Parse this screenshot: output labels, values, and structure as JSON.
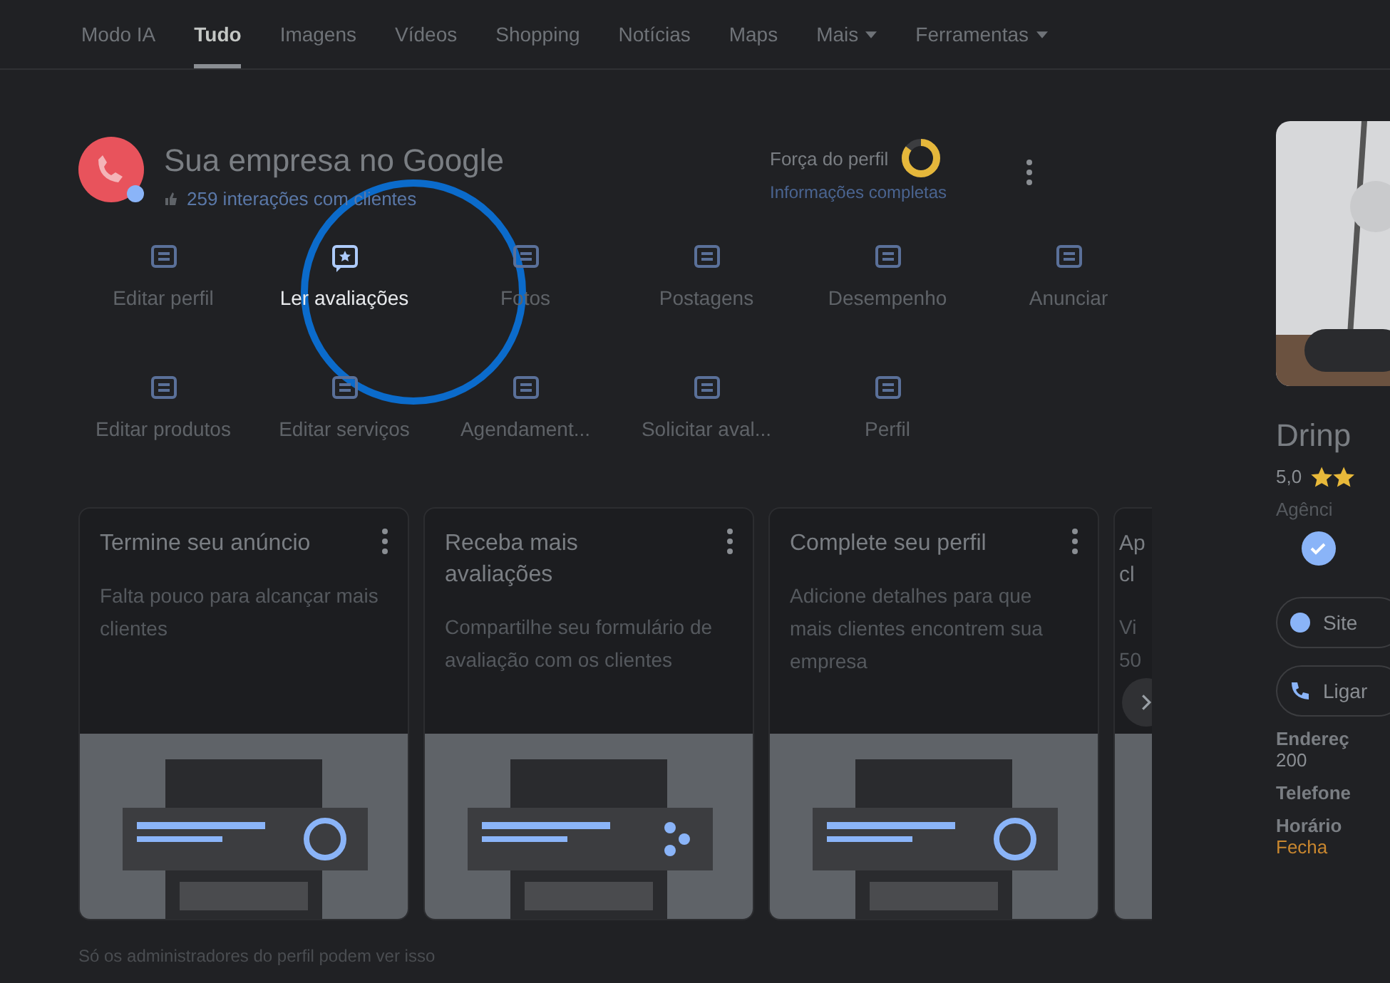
{
  "tabs": [
    {
      "label": "Modo IA",
      "selected": false,
      "has_menu": false
    },
    {
      "label": "Tudo",
      "selected": true,
      "has_menu": false
    },
    {
      "label": "Imagens",
      "selected": false,
      "has_menu": false
    },
    {
      "label": "Vídeos",
      "selected": false,
      "has_menu": false
    },
    {
      "label": "Shopping",
      "selected": false,
      "has_menu": false
    },
    {
      "label": "Notícias",
      "selected": false,
      "has_menu": false
    },
    {
      "label": "Maps",
      "selected": false,
      "has_menu": false
    },
    {
      "label": "Mais",
      "selected": false,
      "has_menu": true
    },
    {
      "label": "Ferramentas",
      "selected": false,
      "has_menu": true
    }
  ],
  "business": {
    "title": "Sua empresa no Google",
    "interactions": "259 interações com clientes",
    "strength": {
      "label": "Força do perfil",
      "level": 0.85,
      "status": "Informações completas"
    }
  },
  "actions": [
    {
      "label": "Editar perfil",
      "highlighted": false
    },
    {
      "label": "Ler avaliações",
      "highlighted": true
    },
    {
      "label": "Fotos",
      "highlighted": false
    },
    {
      "label": "Postagens",
      "highlighted": false
    },
    {
      "label": "Desempenho",
      "highlighted": false
    },
    {
      "label": "Anunciar",
      "highlighted": false
    },
    {
      "label": "Editar produtos",
      "highlighted": false
    },
    {
      "label": "Editar serviços",
      "highlighted": false
    },
    {
      "label": "Agendament...",
      "highlighted": false
    },
    {
      "label": "Solicitar aval...",
      "highlighted": false
    },
    {
      "label": "Perfil",
      "highlighted": false
    }
  ],
  "cards": [
    {
      "title": "Termine seu anúncio",
      "text": "Falta pouco para alcançar mais clientes",
      "partial": false
    },
    {
      "title": "Receba mais avaliações",
      "text": "Compartilhe seu formulário de avaliação com os clientes",
      "partial": false
    },
    {
      "title": "Complete seu perfil",
      "text": "Adicione detalhes para que mais clientes encontrem sua empresa",
      "partial": false
    },
    {
      "title": "Ap cl",
      "text": "Vi 50",
      "partial": true
    }
  ],
  "footer_note": "Só os administradores do perfil podem ver isso",
  "side_panel": {
    "name": "Drinp",
    "rating": "5,0",
    "category": "Agênci",
    "buttons": [
      "Site",
      "Ligar"
    ],
    "details": [
      {
        "label": "Endereç",
        "value": "200"
      },
      {
        "label": "Telefone"
      },
      {
        "label": "Horário",
        "value": "Fecha"
      }
    ]
  }
}
